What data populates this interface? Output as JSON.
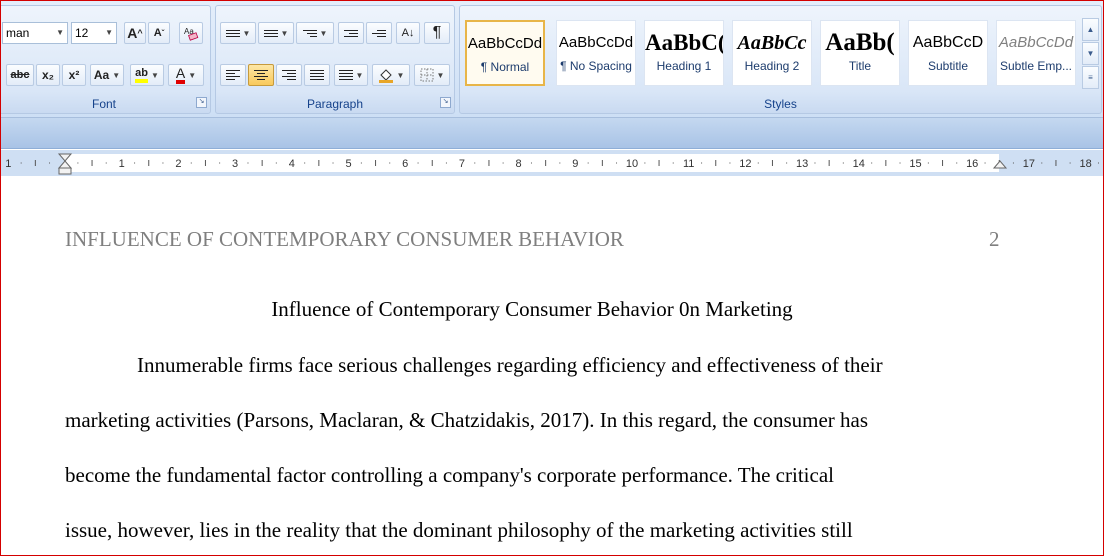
{
  "ribbon": {
    "font": {
      "name_value": "man",
      "size_value": "12",
      "grow_label": "A",
      "shrink_label": "A",
      "strike_label": "abc",
      "subscript_label": "x₂",
      "superscript_label": "x²",
      "case_label": "Aa",
      "highlight_label": "ab",
      "font_color_label": "A",
      "group_label": "Font"
    },
    "paragraph": {
      "sort_label": "A↓",
      "pilcrow_label": "¶",
      "group_label": "Paragraph"
    },
    "styles": {
      "group_label": "Styles",
      "items": [
        {
          "preview": "AaBbCcDd",
          "name": "¶ Normal"
        },
        {
          "preview": "AaBbCcDd",
          "name": "¶ No Spacing"
        },
        {
          "preview": "AaBbC(",
          "name": "Heading 1"
        },
        {
          "preview": "AaBbCc",
          "name": "Heading 2"
        },
        {
          "preview": "AaBb(",
          "name": "Title"
        },
        {
          "preview": "AaBbCcD",
          "name": "Subtitle"
        },
        {
          "preview": "AaBbCcDd",
          "name": "Subtle Emp..."
        }
      ]
    }
  },
  "ruler": {
    "labels": [
      "1",
      "1",
      "2",
      "3",
      "4",
      "5",
      "6",
      "7",
      "8",
      "9",
      "10",
      "11",
      "12",
      "13",
      "14",
      "15",
      "16",
      "17",
      "18"
    ]
  },
  "document": {
    "header_title": "INFLUENCE OF CONTEMPORARY CONSUMER BEHAVIOR",
    "page_number": "2",
    "title": "Influence of Contemporary Consumer Behavior 0n Marketing",
    "body_lines": [
      "Innumerable firms  face serious challenges regarding efficiency and effectiveness of their",
      "marketing activities (Parsons,  Maclaran, & Chatzidakis, 2017). In this regard, the consumer has",
      "become the fundamental factor controlling a company's corporate performance. The critical",
      "issue, however, lies in the reality that the dominant philosophy of the marketing activities still"
    ]
  },
  "colors": {
    "frame_border": "#d40000",
    "group_label": "#15428b",
    "highlight": "#ffff00",
    "font_color": "#e00000",
    "header_text": "#7f7f7f"
  }
}
